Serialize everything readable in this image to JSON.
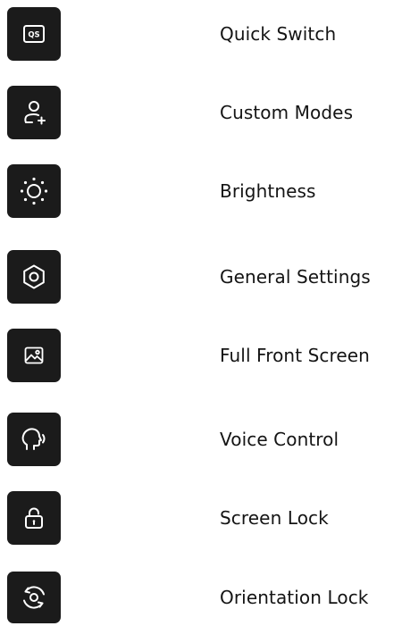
{
  "menu": {
    "items": [
      {
        "label": "Quick Switch",
        "icon": "qs-icon",
        "badge": "QS"
      },
      {
        "label": "Custom Modes",
        "icon": "user-add-icon"
      },
      {
        "label": "Brightness",
        "icon": "sun-icon"
      },
      {
        "label": "General Settings",
        "icon": "hexagon-gear-icon"
      },
      {
        "label": "Full Front Screen",
        "icon": "image-icon"
      },
      {
        "label": "Voice Control",
        "icon": "voice-head-icon"
      },
      {
        "label": "Screen Lock",
        "icon": "lock-icon"
      },
      {
        "label": "Orientation Lock",
        "icon": "rotation-lock-icon"
      }
    ]
  },
  "colors": {
    "tile_background": "#1b1b1b",
    "icon": "#ffffff",
    "text": "#141414",
    "page_background": "#ffffff"
  }
}
